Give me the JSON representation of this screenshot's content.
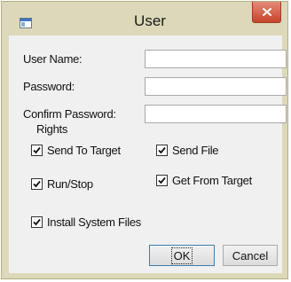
{
  "window": {
    "title": "User"
  },
  "form": {
    "user_name_label": "User Name:",
    "user_name_value": "",
    "password_label": "Password:",
    "password_value": "",
    "confirm_password_label": "Confirm Password:",
    "confirm_password_value": ""
  },
  "rights": {
    "heading": "Rights",
    "send_to_target": {
      "label": "Send To Target",
      "checked": true
    },
    "send_file": {
      "label": "Send File",
      "checked": true
    },
    "run_stop": {
      "label": "Run/Stop",
      "checked": true
    },
    "get_from_target": {
      "label": "Get From Target",
      "checked": true
    },
    "install_system_files": {
      "label": "Install System Files",
      "checked": true
    }
  },
  "buttons": {
    "ok_label": "OK",
    "cancel_label": "Cancel"
  },
  "icons": {
    "app": "window-app-icon",
    "close": "close-icon",
    "check": "checkmark-icon"
  },
  "colors": {
    "frame": "#dcd8b9",
    "close": "#c7432c",
    "client": "#f0f0f0"
  }
}
